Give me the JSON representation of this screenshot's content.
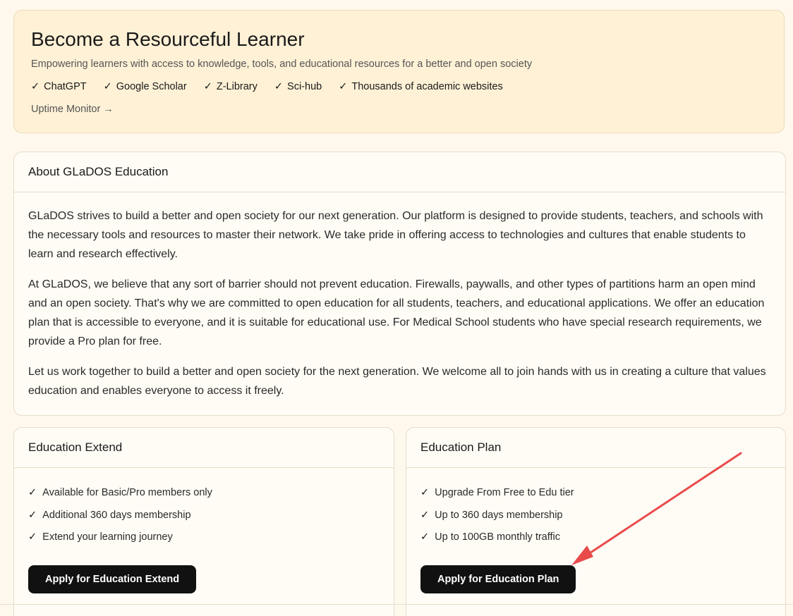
{
  "hero": {
    "title": "Become a Resourceful Learner",
    "subtitle": "Empowering learners with access to knowledge, tools, and educational resources for a better and open society",
    "features": [
      "ChatGPT",
      "Google Scholar",
      "Z-Library",
      "Sci-hub",
      "Thousands of academic websites"
    ],
    "uptime_link": "Uptime Monitor →"
  },
  "about": {
    "title": "About GLaDOS Education",
    "paragraphs": [
      "GLaDOS strives to build a better and open society for our next generation. Our platform is designed to provide students, teachers, and schools with the necessary tools and resources to master their network. We take pride in offering access to technologies and cultures that enable students to learn and research effectively.",
      "At GLaDOS, we believe that any sort of barrier should not prevent education. Firewalls, paywalls, and other types of partitions harm an open mind and an open society. That's why we are committed to open education for all students, teachers, and educational applications. We offer an education plan that is accessible to everyone, and it is suitable for educational use. For Medical School students who have special research requirements, we provide a Pro plan for free.",
      "Let us work together to build a better and open society for the next generation. We welcome all to join hands with us in creating a culture that values education and enables everyone to access it freely."
    ]
  },
  "extend": {
    "title": "Education Extend",
    "items": [
      "Available for Basic/Pro members only",
      "Additional 360 days membership",
      "Extend your learning journey"
    ],
    "button": "Apply for Education Extend"
  },
  "plan": {
    "title": "Education Plan",
    "items": [
      "Upgrade From Free to Edu tier",
      "Up to 360 days membership",
      "Up to 100GB monthly traffic"
    ],
    "button": "Apply for Education Plan"
  },
  "check_glyph": "✓",
  "colors": {
    "background": "#fff8ec",
    "hero_background": "#fff1d6",
    "button": "#111111",
    "annotation_arrow": "#e84a4a"
  }
}
